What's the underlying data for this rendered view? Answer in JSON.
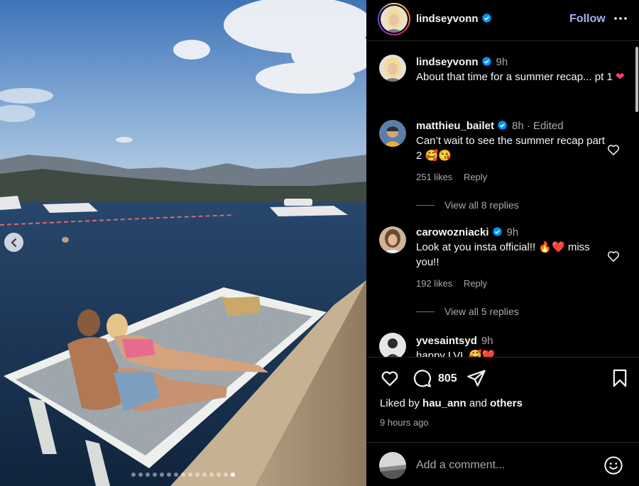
{
  "post": {
    "author": "lindseyvonn",
    "follow_label": "Follow",
    "caption_time": "9h",
    "caption": "About that time for a summer recap... pt 1"
  },
  "photo": {
    "slides_total": 15,
    "active_slide": 15
  },
  "comments": [
    {
      "username": "matthieu_bailet",
      "time": "8h · Edited",
      "text": "Can’t wait to see the summer recap part 2 🥰😘",
      "likes": "251 likes",
      "reply_label": "Reply",
      "view_replies": "View all 8 replies"
    },
    {
      "username": "carowozniacki",
      "time": "9h",
      "text": "Look at you insta official!! 🔥❤️ miss you!!",
      "likes": "192 likes",
      "reply_label": "Reply",
      "view_replies": "View all 5 replies"
    },
    {
      "username": "yvesaintsyd",
      "time": "9h",
      "text": "happy LVL 🥰❤️"
    }
  ],
  "actions": {
    "comment_count": "805",
    "liked_by_prefix": "Liked by",
    "liked_by_user": "hau_ann",
    "liked_by_and": "and",
    "liked_by_others": "others",
    "time_ago": "9 hours ago"
  },
  "add_comment": {
    "placeholder": "Add a comment..."
  },
  "colors": {
    "follow": "#a7aef7",
    "verified": "#0095f6",
    "heart_emoji": "#ff3e6c",
    "background": "#000000",
    "muted_text": "#a8a8a8"
  },
  "icons": [
    "verified-icon",
    "more-icon",
    "heart-icon",
    "comment-icon",
    "share-icon",
    "save-icon",
    "emoji-icon",
    "chevron-left-icon"
  ]
}
